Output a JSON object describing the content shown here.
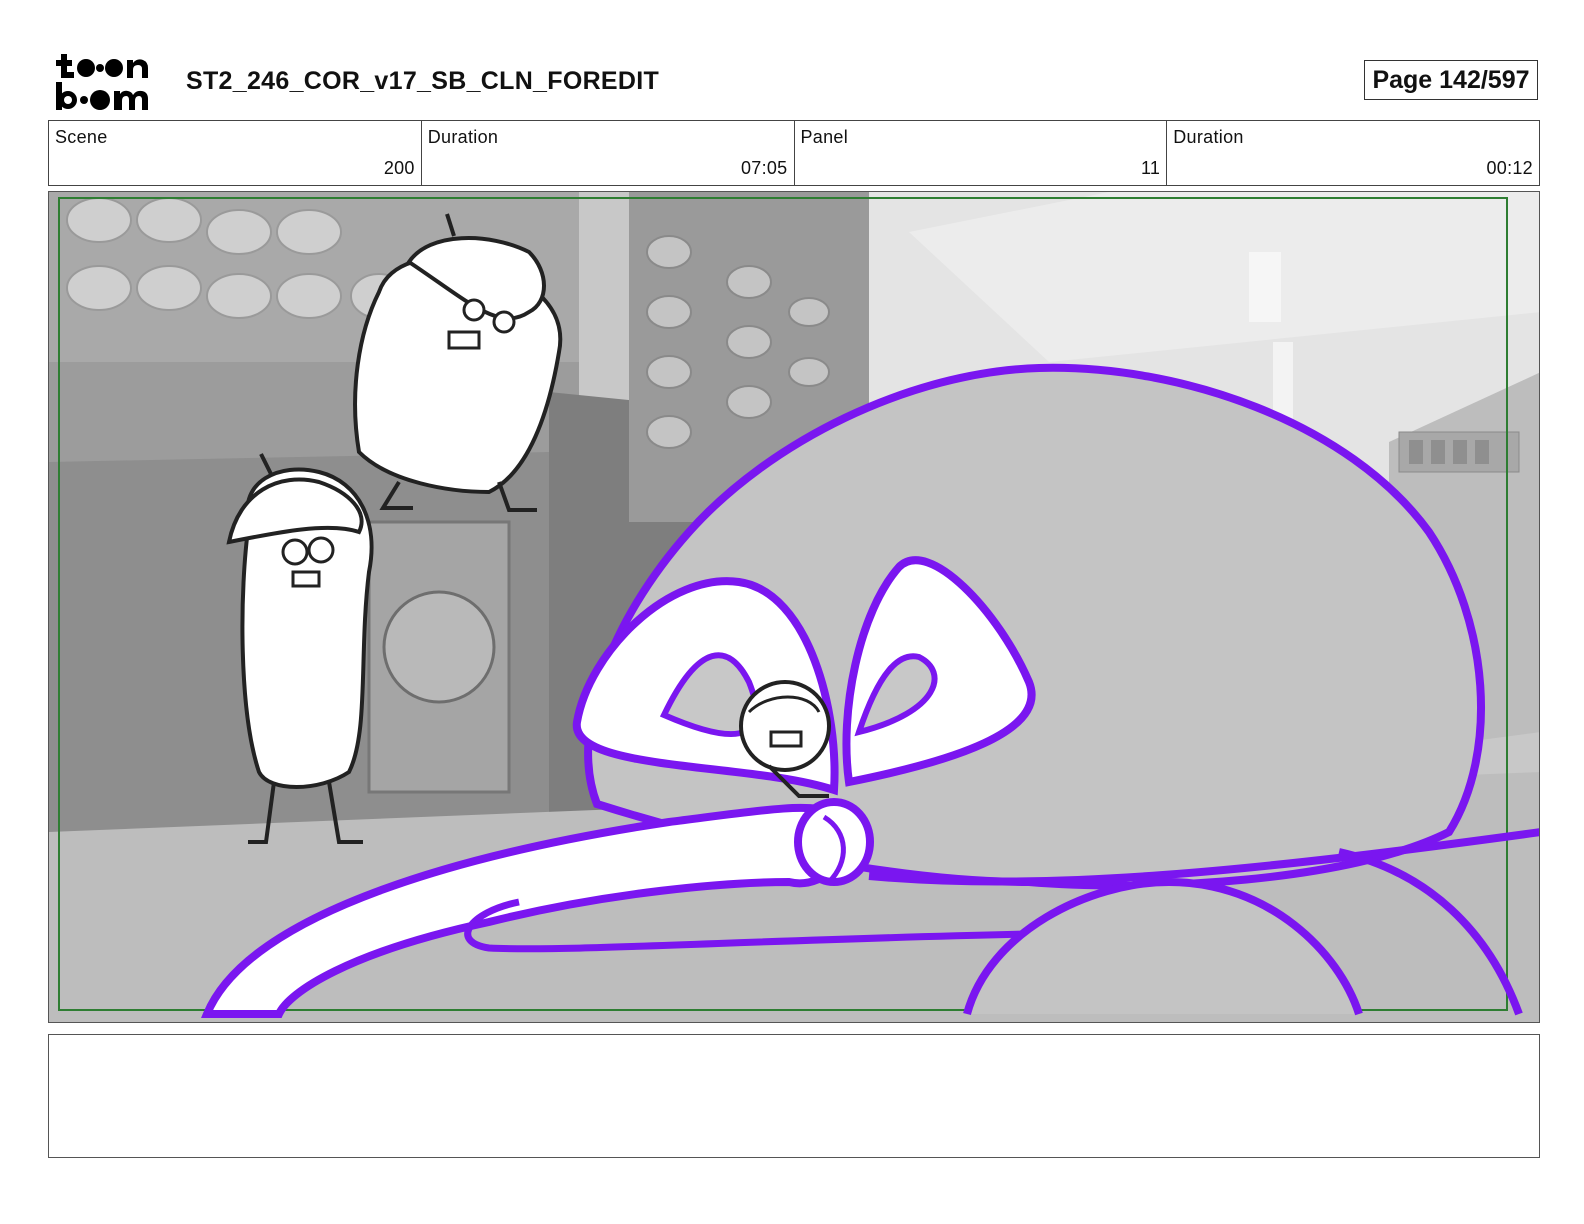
{
  "header": {
    "logo_text": "toonboom",
    "title": "ST2_246_COR_v17_SB_CLN_FOREDIT",
    "page_label": "Page 142/597"
  },
  "info": {
    "scene_label": "Scene",
    "scene_value": "200",
    "scene_duration_label": "Duration",
    "scene_duration_value": "07:05",
    "panel_label": "Panel",
    "panel_value": "11",
    "panel_duration_label": "Duration",
    "panel_duration_value": "00:12"
  },
  "panel": {
    "safe_frame_color": "#2e7d32",
    "outline_color": "#7a16f0",
    "background_tone": "#cfcfcf"
  },
  "notes": {
    "text": ""
  }
}
